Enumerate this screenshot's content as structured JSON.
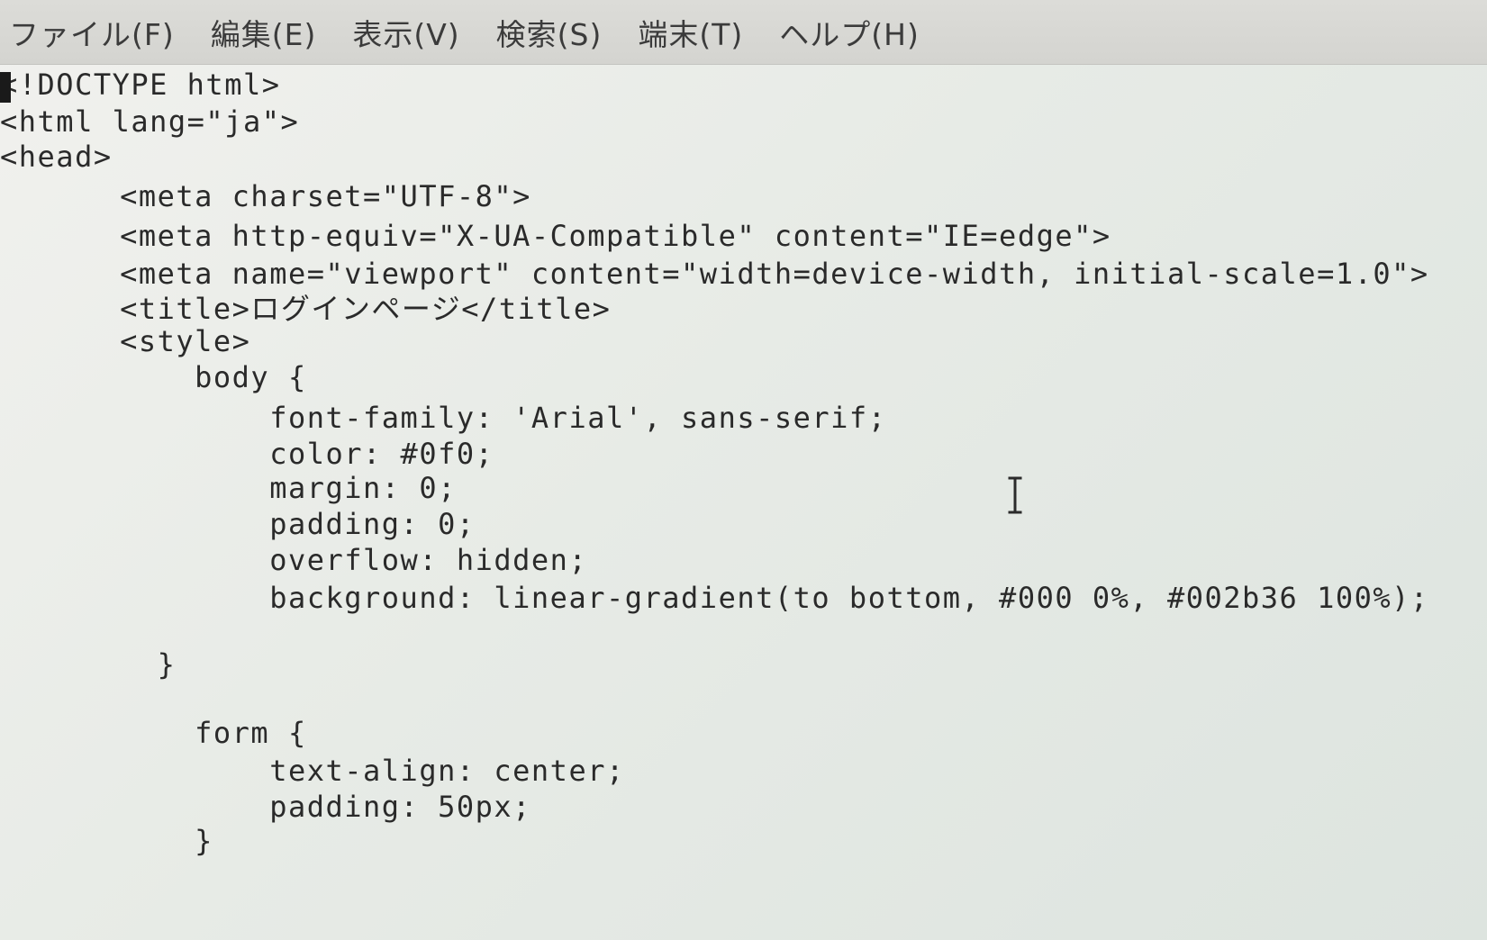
{
  "menubar": {
    "items": [
      "ファイル(F)",
      "編集(E)",
      "表示(V)",
      "検索(S)",
      "端末(T)",
      "ヘルプ(H)"
    ]
  },
  "editor": {
    "lines": [
      "<!DOCTYPE html>",
      "<html lang=\"ja\">",
      "<head>",
      "    <meta charset=\"UTF-8\">",
      "    <meta http-equiv=\"X-UA-Compatible\" content=\"IE=edge\">",
      "    <meta name=\"viewport\" content=\"width=device-width, initial-scale=1.0\">",
      "    <title>ログインページ</title>",
      "    <style>",
      "        body {",
      "            font-family: 'Arial', sans-serif;",
      "            color: #0f0;",
      "            margin: 0;",
      "            padding: 0;",
      "            overflow: hidden;",
      "            background: linear-gradient(to bottom, #000 0%, #002b36 100%);",
      "",
      "      }",
      "",
      "        form {",
      "            text-align: center;",
      "            padding: 50px;",
      "        }"
    ]
  },
  "icons": {
    "text_cursor": "ibeam-cursor-icon"
  }
}
